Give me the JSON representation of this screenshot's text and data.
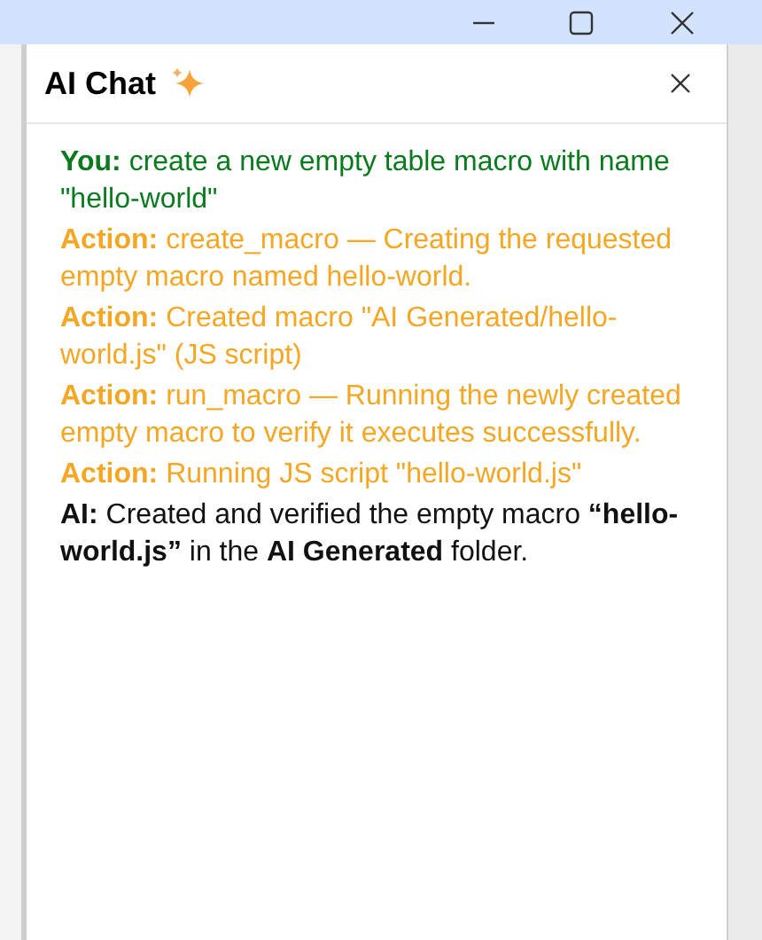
{
  "panel": {
    "title": "AI Chat"
  },
  "messages": [
    {
      "kind": "user",
      "label": "You:",
      "text": "create a new empty table macro with name \"hello-world\""
    },
    {
      "kind": "action",
      "label": "Action:",
      "text": "create_macro — Creating the requested empty macro named hello-world."
    },
    {
      "kind": "action",
      "label": "Action:",
      "text": "Created macro \"AI Generated/hello-world.js\" (JS script)"
    },
    {
      "kind": "action",
      "label": "Action:",
      "text": "run_macro — Running the newly created empty macro to verify it executes successfully."
    },
    {
      "kind": "action",
      "label": "Action:",
      "text": "Running JS script \"hello-world.js\""
    },
    {
      "kind": "ai",
      "label": "AI:",
      "text": "Created and verified the empty macro **“hello-world.js”** in the **AI Generated** folder."
    }
  ]
}
